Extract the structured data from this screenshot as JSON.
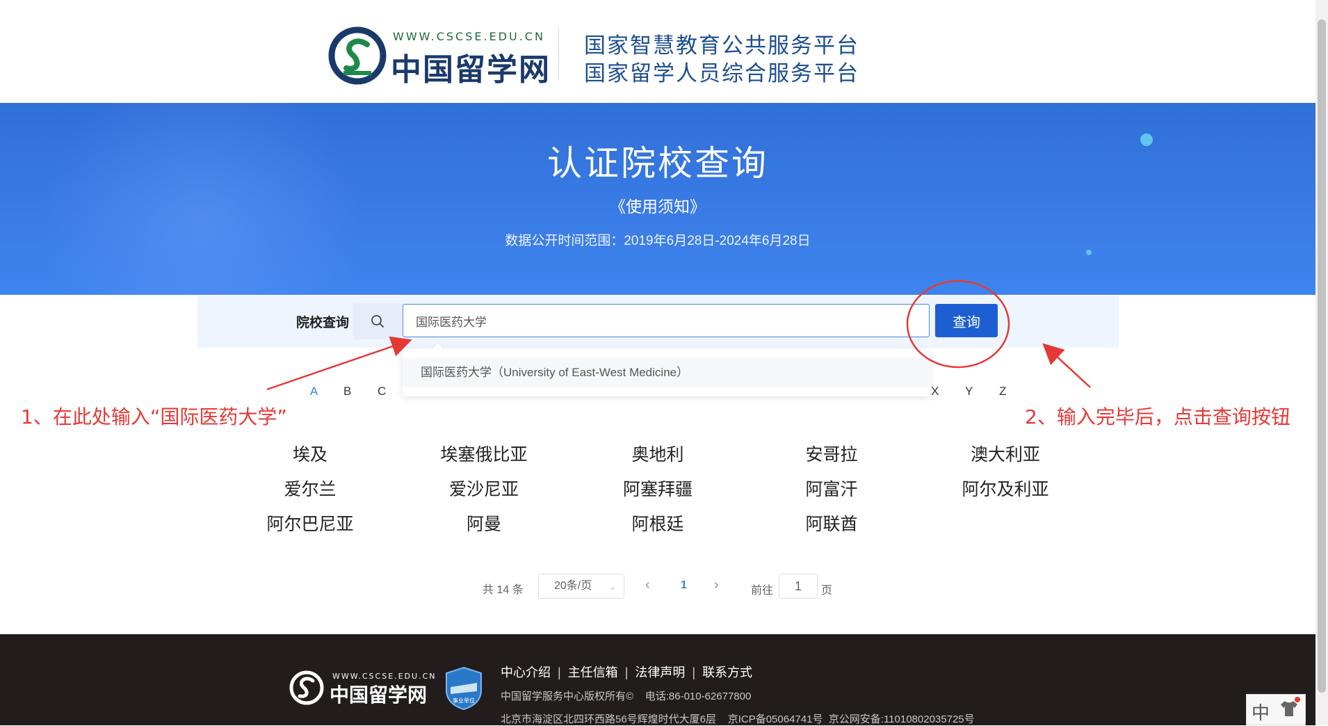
{
  "header": {
    "site_url": "WWW.CSCSE.EDU.CN",
    "site_name": "中国留学网",
    "platform_line1": "国家智慧教育公共服务平台",
    "platform_line2": "国家留学人员综合服务平台"
  },
  "banner": {
    "title": "认证院校查询",
    "notice_link": "《使用须知》",
    "date_range": "数据公开时间范围：2019年6月28日-2024年6月28日"
  },
  "search": {
    "label": "院校查询",
    "value": "国际医药大学",
    "button_label": "查询",
    "suggestion": "国际医药大学（University of East-West Medicine）"
  },
  "alphabet": {
    "left": [
      "A",
      "B",
      "C"
    ],
    "right": [
      "X",
      "Y",
      "Z"
    ],
    "active": "A"
  },
  "annotations": {
    "note1": "1、在此处输入“国际医药大学”",
    "note2": "2、输入完毕后，点击查询按钮"
  },
  "countries": [
    [
      "埃及",
      "埃塞俄比亚",
      "奥地利",
      "安哥拉",
      "澳大利亚"
    ],
    [
      "爱尔兰",
      "爱沙尼亚",
      "阿塞拜疆",
      "阿富汗",
      "阿尔及利亚"
    ],
    [
      "阿尔巴尼亚",
      "阿曼",
      "阿根廷",
      "阿联酋"
    ]
  ],
  "pagination": {
    "total_text": "共 14 条",
    "page_size": "20条/页",
    "current_page": "1",
    "goto_prefix": "前往",
    "goto_value": "1",
    "goto_suffix": "页"
  },
  "footer": {
    "site_url": "WWW.CSCSE.EDU.CN",
    "site_name": "中国留学网",
    "badge_text": "事业单位",
    "links": [
      "中心介绍",
      "主任信箱",
      "法律声明",
      "联系方式"
    ],
    "copyright": "中国留学服务中心版权所有©    电话:86-010-62677800",
    "address": "北京市海淀区北四环西路56号辉煌时代大厦6层    京ICP备05064741号  京公网安备:11010802035725号"
  },
  "ime": {
    "mode": "中"
  },
  "colors": {
    "brand_blue": "#1d5fd3",
    "banner_blue": "#3a7ce6",
    "annotation_red": "#e53935",
    "footer_bg": "#221c1c"
  }
}
